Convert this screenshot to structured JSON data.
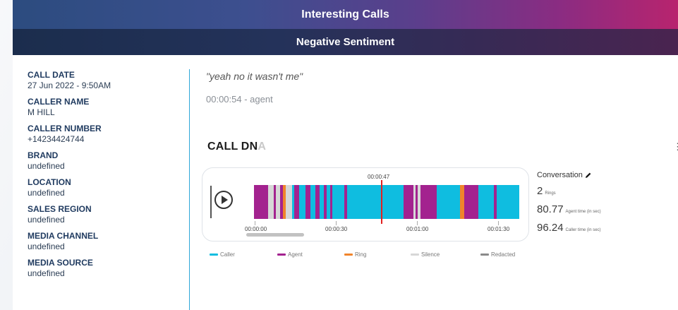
{
  "header": {
    "title": "Interesting Calls",
    "subtitle": "Negative Sentiment"
  },
  "call_details": [
    {
      "label": "CALL DATE",
      "value": "27 Jun 2022 - 9:50AM"
    },
    {
      "label": "CALLER NAME",
      "value": "M HILL"
    },
    {
      "label": "CALLER NUMBER",
      "value": "+14234424744"
    },
    {
      "label": "BRAND",
      "value": "undefined"
    },
    {
      "label": "LOCATION",
      "value": "undefined"
    },
    {
      "label": "SALES REGION",
      "value": "undefined"
    },
    {
      "label": "MEDIA CHANNEL",
      "value": "undefined"
    },
    {
      "label": "MEDIA SOURCE",
      "value": "undefined"
    }
  ],
  "transcript": {
    "quote": "\"yeah no it wasn't me\"",
    "timestamp": "00:00:54 - agent"
  },
  "call_dna": {
    "title_main": "CALL DN",
    "title_faded": "A",
    "marker_label": "00:00:47",
    "ticks": [
      "00:00:00",
      "00:00:30",
      "00:01:00",
      "00:01:30"
    ],
    "legend": [
      {
        "label": "Caller",
        "color": "#0fbde0"
      },
      {
        "label": "Agent",
        "color": "#a3228f"
      },
      {
        "label": "Ring",
        "color": "#f0842b"
      },
      {
        "label": "Silence",
        "color": "#d7d7d7"
      },
      {
        "label": "Redacted",
        "color": "#8a8a8a"
      }
    ],
    "segments_colors": {
      "caller": "#0fbde0",
      "agent": "#a3228f",
      "ring": "#f0842b",
      "silence": "#d7d7d7",
      "marker": "#e32020"
    }
  },
  "conversation": {
    "title": "Conversation",
    "rings_value": "2",
    "rings_label": "Rings",
    "agent_time_value": "80.77",
    "agent_time_label": "Agent time (in sec)",
    "caller_time_value": "96.24",
    "caller_time_label": "Caller time (in sec)"
  },
  "icons": {
    "edit": "pencil-icon",
    "play": "play-icon"
  }
}
